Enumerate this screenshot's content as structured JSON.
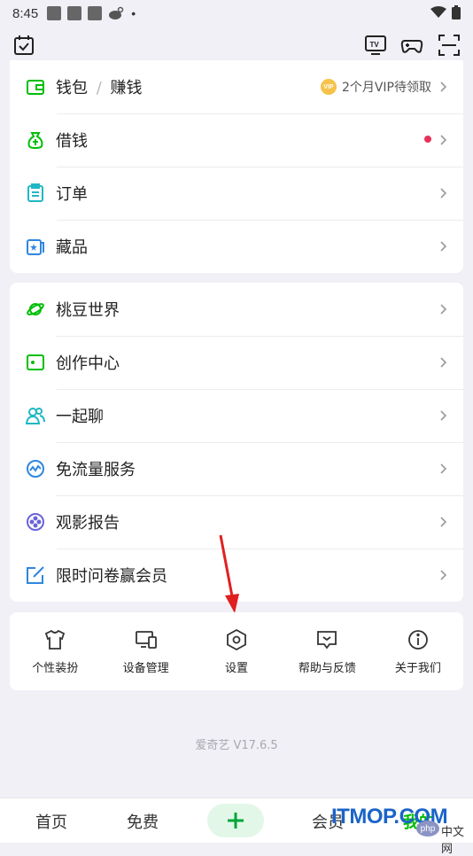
{
  "status_bar": {
    "time": "8:45"
  },
  "colors": {
    "brand_green": "#00be06",
    "accent_cyan": "#1fb8c4",
    "badge_red": "#e8325a",
    "vip_gold": "#f6c24a",
    "arrow_red": "#e02020"
  },
  "card1": {
    "items": [
      {
        "label": "钱包",
        "sep": "/",
        "label2": "赚钱",
        "extra": "2个月VIP待领取",
        "badge": "VIP",
        "icon": "wallet-icon"
      },
      {
        "label": "借钱",
        "icon": "money-bag-icon",
        "has_dot": true
      },
      {
        "label": "订单",
        "icon": "clipboard-icon"
      },
      {
        "label": "藏品",
        "icon": "collection-icon"
      }
    ]
  },
  "card2": {
    "items": [
      {
        "label": "桃豆世界",
        "icon": "planet-icon"
      },
      {
        "label": "创作中心",
        "icon": "creator-icon"
      },
      {
        "label": "一起聊",
        "icon": "chat-people-icon"
      },
      {
        "label": "免流量服务",
        "icon": "data-free-icon"
      },
      {
        "label": "观影报告",
        "icon": "film-report-icon"
      },
      {
        "label": "限时问卷赢会员",
        "icon": "survey-icon"
      }
    ]
  },
  "tools": [
    {
      "label": "个性装扮",
      "icon": "tshirt-icon"
    },
    {
      "label": "设备管理",
      "icon": "devices-icon"
    },
    {
      "label": "设置",
      "icon": "settings-hex-icon"
    },
    {
      "label": "帮助与反馈",
      "icon": "help-feedback-icon"
    },
    {
      "label": "关于我们",
      "icon": "info-icon"
    }
  ],
  "version": "爱奇艺 V17.6.5",
  "bottom_nav": {
    "home": "首页",
    "free": "免费",
    "vip": "会员",
    "me": "我的"
  },
  "watermark": {
    "text": "ITMOP.COM",
    "php": "php",
    "cn": "中文网"
  }
}
